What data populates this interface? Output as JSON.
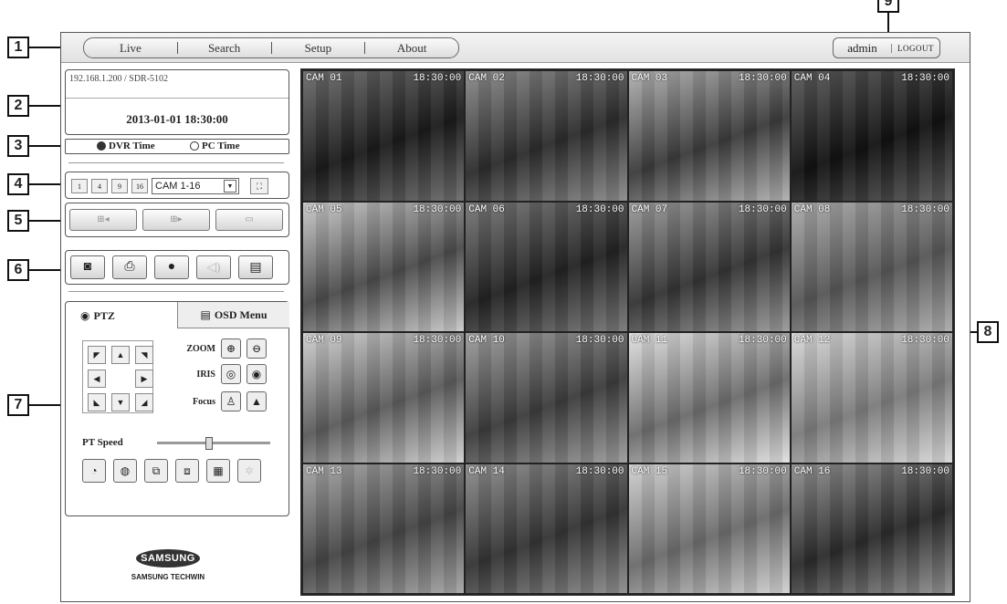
{
  "callouts": [
    "1",
    "2",
    "3",
    "4",
    "5",
    "6",
    "7",
    "8",
    "9"
  ],
  "menu": {
    "items": [
      "Live",
      "Search",
      "Setup",
      "About"
    ]
  },
  "user": {
    "name": "admin",
    "logout": "LOGOUT"
  },
  "device": {
    "address": "192.168.1.200 / SDR-5102",
    "datetime": "2013-01-01 18:30:00"
  },
  "time_source": {
    "dvr": "DVR Time",
    "pc": "PC Time",
    "selected": "dvr"
  },
  "layout": {
    "buttons": [
      "1",
      "4",
      "9",
      "16"
    ],
    "camera_select": "CAM 1-16"
  },
  "ptz": {
    "tab_ptz": "PTZ",
    "tab_osd": "OSD Menu",
    "zoom": "ZOOM",
    "iris": "IRIS",
    "focus": "Focus",
    "speed_label": "PT Speed",
    "speed_value": 0.45
  },
  "brand": {
    "logo": "SAMSUNG",
    "sub": "SAMSUNG TECHWIN"
  },
  "cameras": [
    {
      "label": "CAM 01",
      "time": "18:30:00"
    },
    {
      "label": "CAM 02",
      "time": "18:30:00"
    },
    {
      "label": "CAM 03",
      "time": "18:30:00"
    },
    {
      "label": "CAM 04",
      "time": "18:30:00"
    },
    {
      "label": "CAM 05",
      "time": "18:30:00"
    },
    {
      "label": "CAM 06",
      "time": "18:30:00"
    },
    {
      "label": "CAM 07",
      "time": "18:30:00"
    },
    {
      "label": "CAM 08",
      "time": "18:30:00"
    },
    {
      "label": "CAM 09",
      "time": "18:30:00"
    },
    {
      "label": "CAM 10",
      "time": "18:30:00"
    },
    {
      "label": "CAM 11",
      "time": "18:30:00"
    },
    {
      "label": "CAM 12",
      "time": "18:30:00"
    },
    {
      "label": "CAM 13",
      "time": "18:30:00"
    },
    {
      "label": "CAM 14",
      "time": "18:30:00"
    },
    {
      "label": "CAM 15",
      "time": "18:30:00"
    },
    {
      "label": "CAM 16",
      "time": "18:30:00"
    }
  ]
}
